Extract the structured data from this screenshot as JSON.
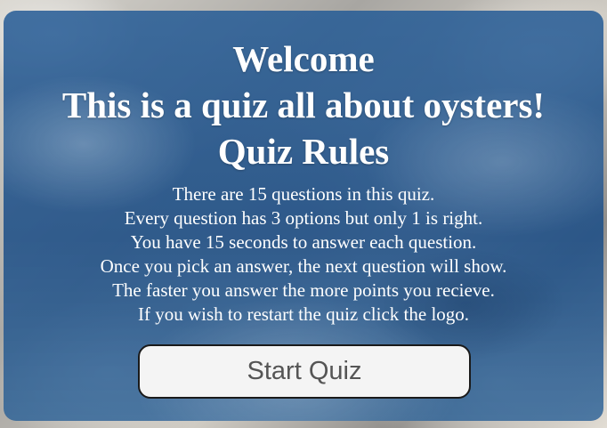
{
  "welcome": {
    "title": "Welcome",
    "subtitle": "This is a quiz all about oysters!",
    "rules_heading": "Quiz Rules"
  },
  "rules": [
    "There are 15 questions in this quiz.",
    "Every question has 3 options but only 1 is right.",
    "You have 15 seconds to answer each question.",
    "Once you pick an answer, the next question will show.",
    "The faster you answer the more points you recieve.",
    "If you wish to restart the quiz click the logo."
  ],
  "start_button": {
    "label": "Start Quiz"
  },
  "colors": {
    "panel": "#265c96",
    "text": "#ffffff",
    "button_bg": "#f4f4f4",
    "button_text": "#555555",
    "button_border": "#1a1a1a"
  }
}
